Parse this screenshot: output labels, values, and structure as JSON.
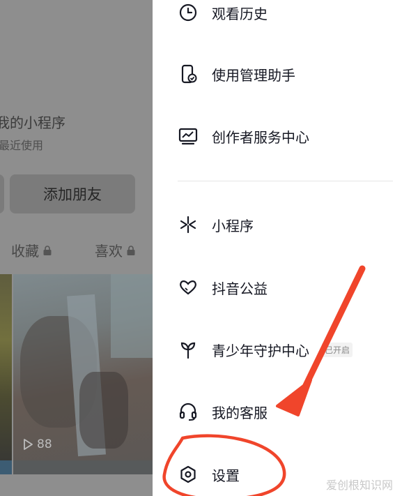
{
  "background": {
    "mini_program_title": "我的小程序",
    "mini_program_subtitle": "最近使用",
    "add_friend_label": "添加朋友",
    "tabs": [
      {
        "label": "收藏"
      },
      {
        "label": "喜欢"
      }
    ],
    "play_count": "88"
  },
  "drawer": {
    "items": [
      {
        "label": "观看历史",
        "icon": "clock-icon"
      },
      {
        "label": "使用管理助手",
        "icon": "phone-check-icon"
      },
      {
        "label": "创作者服务中心",
        "icon": "chart-icon"
      },
      {
        "label": "小程序",
        "icon": "mini-program-icon"
      },
      {
        "label": "抖音公益",
        "icon": "heart-hands-icon"
      },
      {
        "label": "青少年守护中心",
        "icon": "sprout-icon",
        "badge": "已开启"
      },
      {
        "label": "我的客服",
        "icon": "headset-icon"
      },
      {
        "label": "设置",
        "icon": "settings-icon"
      }
    ]
  },
  "watermark": "爱创根知识网",
  "colors": {
    "dim_overlay": "#8e8e8e",
    "annotation_red": "#f0452b",
    "text_primary": "#161823"
  }
}
